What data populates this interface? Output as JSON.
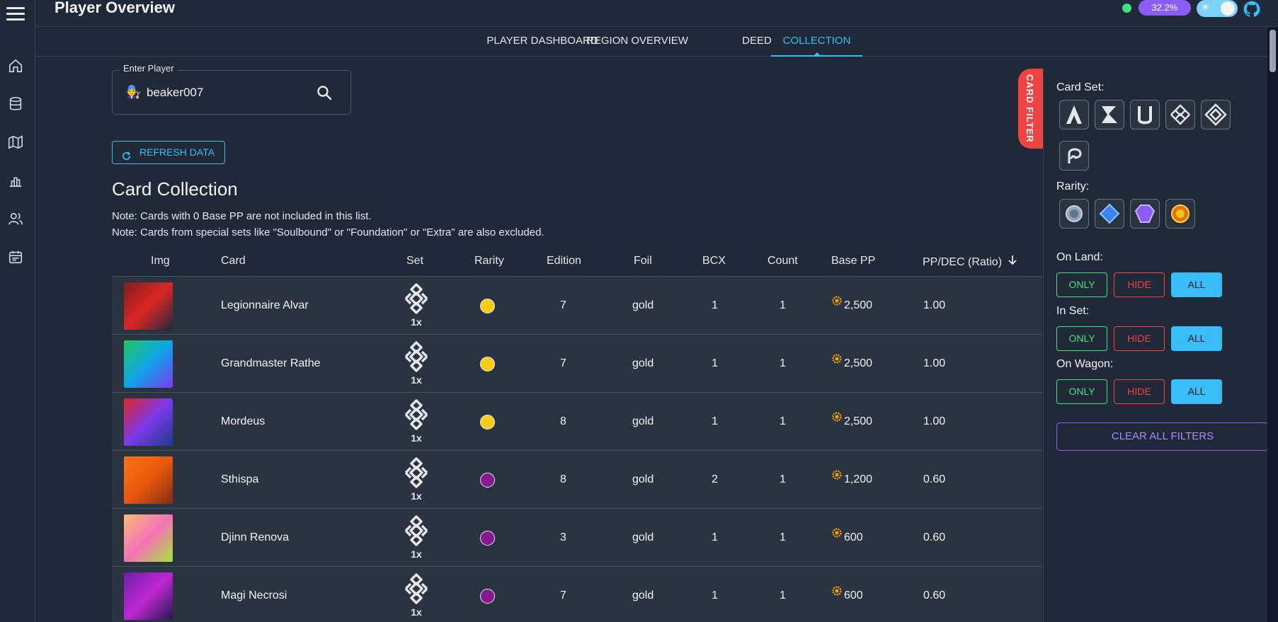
{
  "header": {
    "title": "Player Overview",
    "percent_badge": "32.2%",
    "theme_icon": "sun-icon",
    "github_icon": "github-icon"
  },
  "tabs": [
    {
      "label": "Player Dashboard"
    },
    {
      "label": "Region Overview"
    },
    {
      "label": "Deed"
    },
    {
      "label": "Collection",
      "active": true
    }
  ],
  "player": {
    "legend": "Enter Player",
    "value": "beaker007"
  },
  "refresh_label": "Refresh Data",
  "section_title": "Card Collection",
  "notes": [
    "Note: Cards with 0 Base PP are not included in this list.",
    "Note: Cards from special sets like \"Soulbound\" or \"Foundation\" or \"Extra\" are also excluded."
  ],
  "table": {
    "columns": [
      "Img",
      "Card",
      "Set",
      "Rarity",
      "Edition",
      "Foil",
      "BCX",
      "Count",
      "Base PP",
      "PP/DEC (Ratio)"
    ],
    "sort_icon": "arrow-down-icon",
    "rows": [
      {
        "card": "Legionnaire Alvar",
        "set_mult": "1x",
        "rarity_color": "#facc15",
        "edition": "7",
        "foil": "gold",
        "bcx": "1",
        "count": "1",
        "base_pp": "2,500",
        "ratio": "1.00",
        "img_colors": [
          "#7f1d1d",
          "#dc2626",
          "#1f2937"
        ]
      },
      {
        "card": "Grandmaster Rathe",
        "set_mult": "1x",
        "rarity_color": "#facc15",
        "edition": "7",
        "foil": "gold",
        "bcx": "1",
        "count": "1",
        "base_pp": "2,500",
        "ratio": "1.00",
        "img_colors": [
          "#22c55e",
          "#0ea5e9",
          "#7c3aed"
        ]
      },
      {
        "card": "Mordeus",
        "set_mult": "1x",
        "rarity_color": "#facc15",
        "edition": "8",
        "foil": "gold",
        "bcx": "1",
        "count": "1",
        "base_pp": "2,500",
        "ratio": "1.00",
        "img_colors": [
          "#dc2626",
          "#7c3aed",
          "#1e3a8a"
        ]
      },
      {
        "card": "Sthispa",
        "set_mult": "1x",
        "rarity_color": "#86198f",
        "edition": "8",
        "foil": "gold",
        "bcx": "2",
        "count": "1",
        "base_pp": "1,200",
        "ratio": "0.60",
        "img_colors": [
          "#f97316",
          "#ea580c",
          "#7c2d12"
        ]
      },
      {
        "card": "Djinn Renova",
        "set_mult": "1x",
        "rarity_color": "#86198f",
        "edition": "3",
        "foil": "gold",
        "bcx": "1",
        "count": "1",
        "base_pp": "600",
        "ratio": "0.60",
        "img_colors": [
          "#fdba74",
          "#f472b6",
          "#a3e635"
        ]
      },
      {
        "card": "Magi Necrosi",
        "set_mult": "1x",
        "rarity_color": "#86198f",
        "edition": "7",
        "foil": "gold",
        "bcx": "1",
        "count": "1",
        "base_pp": "600",
        "ratio": "0.60",
        "img_colors": [
          "#6b21a8",
          "#c026d3",
          "#1e1b4b"
        ]
      }
    ]
  },
  "filter": {
    "tab_label": "CARD FILTER",
    "card_set_label": "Card Set:",
    "rarity_label": "Rarity:",
    "groups": [
      {
        "label": "On Land:",
        "only": "Only",
        "hide": "Hide",
        "all": "All"
      },
      {
        "label": "In Set:",
        "only": "Only",
        "hide": "Hide",
        "all": "All"
      },
      {
        "label": "On Wagon:",
        "only": "Only",
        "hide": "Hide",
        "all": "All"
      }
    ],
    "clear_label": "Clear All Filters",
    "accent": "#38bdf8"
  }
}
